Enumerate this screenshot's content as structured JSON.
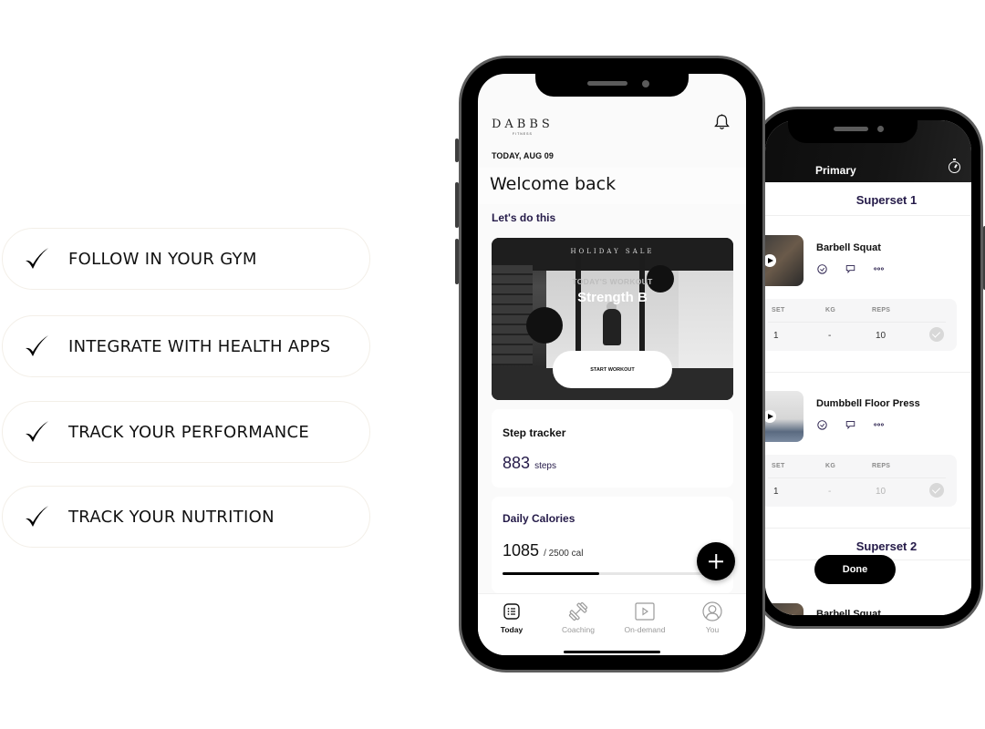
{
  "features": [
    {
      "label": "FOLLOW IN YOUR GYM",
      "icon": "checkmark-icon"
    },
    {
      "label": "INTEGRATE WITH HEALTH APPS",
      "icon": "checkmark-icon"
    },
    {
      "label": "TRACK YOUR PERFORMANCE",
      "icon": "checkmark-icon"
    },
    {
      "label": "TRACK YOUR NUTRITION",
      "icon": "checkmark-icon"
    }
  ],
  "front_phone": {
    "logo": {
      "word": "DABBS",
      "sub": "FITNESS"
    },
    "date": "TODAY, AUG 09",
    "welcome": "Welcome back",
    "subtitle": "Let's do this",
    "workout_card": {
      "banner": "HOLIDAY SALE",
      "label": "TODAY'S WORKOUT",
      "name": "Strength B",
      "button": "START WORKOUT"
    },
    "step_tracker": {
      "title": "Step tracker",
      "value": "883",
      "unit": "steps"
    },
    "daily_calories": {
      "title": "Daily Calories",
      "value": "1085",
      "unit": "/ 2500 cal",
      "progress": 0.47
    },
    "tabs": [
      {
        "label": "Today",
        "icon": "list-icon",
        "active": true
      },
      {
        "label": "Coaching",
        "icon": "dumbbell-icon",
        "active": false
      },
      {
        "label": "On-demand",
        "icon": "play-icon",
        "active": false
      },
      {
        "label": "You",
        "icon": "user-icon",
        "active": false
      }
    ]
  },
  "back_phone": {
    "title": "Primary",
    "supersets": [
      {
        "title": "Superset 1",
        "exercises": [
          {
            "name": "Barbell Squat",
            "headers": [
              "SET",
              "KG",
              "REPS"
            ],
            "row": [
              "1",
              "-",
              "10"
            ]
          },
          {
            "name": "Dumbbell Floor Press",
            "headers": [
              "SET",
              "KG",
              "REPS"
            ],
            "row": [
              "1",
              "-",
              "10"
            ]
          }
        ]
      },
      {
        "title": "Superset 2",
        "exercises": [
          {
            "name": "Barbell Squat"
          }
        ]
      }
    ],
    "done_button": "Done"
  },
  "colors": {
    "accent": "#241a48",
    "primary": "#000000"
  }
}
